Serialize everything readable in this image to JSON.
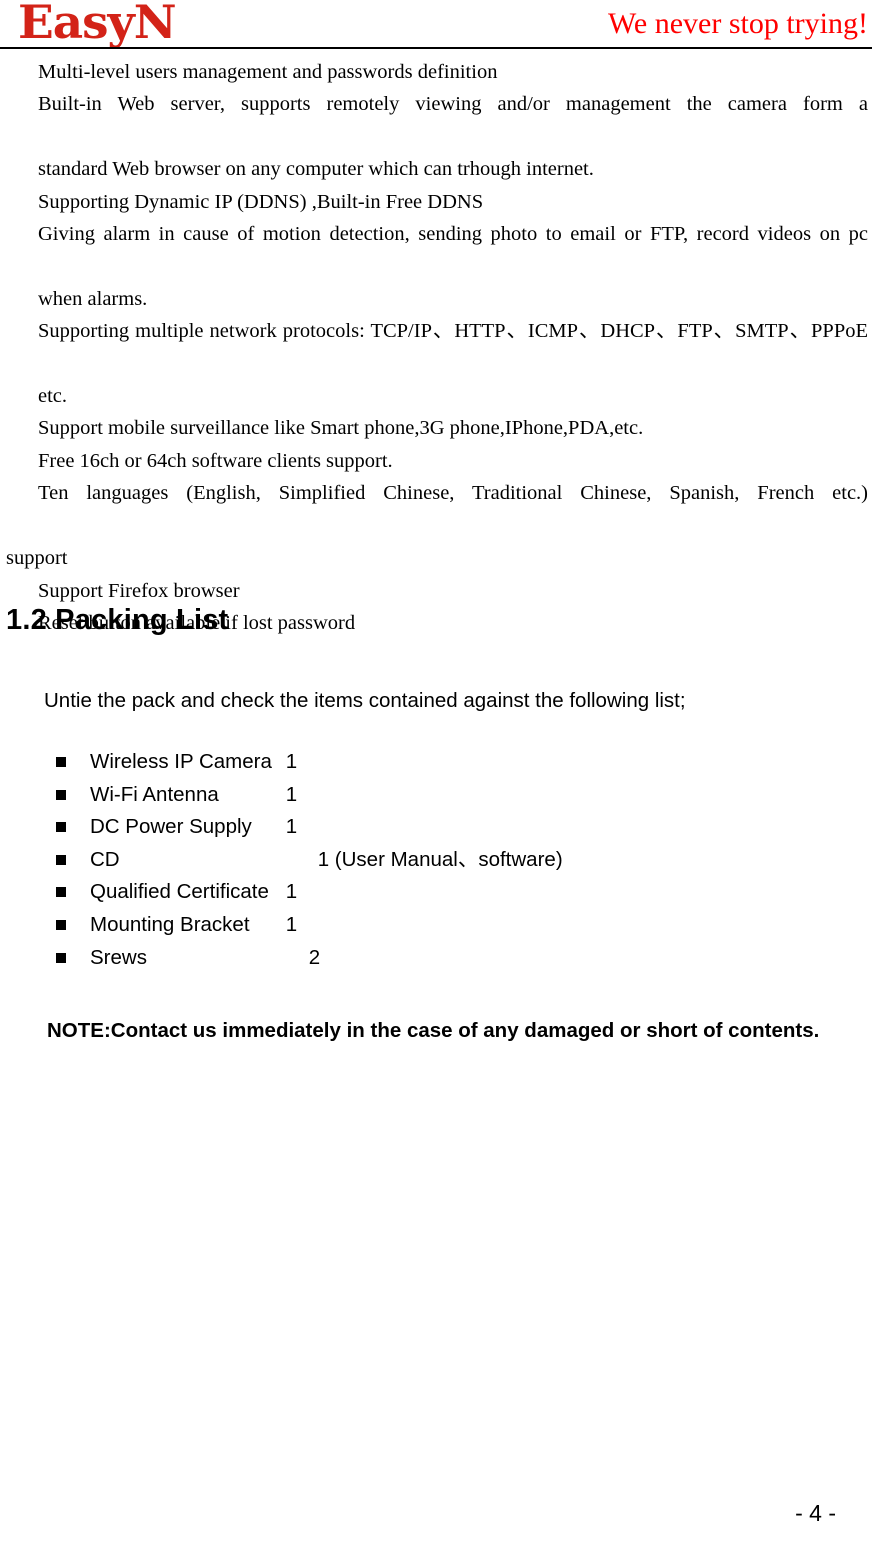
{
  "header": {
    "brand_logo": "EasyN",
    "tagline": "We never stop trying!",
    "logo_color": "#D32318",
    "tagline_color": "#FF0000"
  },
  "features": {
    "lines": [
      "Multi-level users management and passwords definition",
      "Built-in Web server, supports remotely viewing and/or management the camera form a standard Web browser on any computer which can trhough internet.",
      "Supporting Dynamic IP (DDNS) ,Built-in Free DDNS",
      "Giving alarm in cause of motion detection, sending photo to email or FTP, record videos on pc when alarms.",
      "Supporting multiple network protocols: TCP/IP、HTTP、ICMP、DHCP、FTP、SMTP、PPPoE etc.",
      "Support mobile surveillance like Smart phone,3G phone,IPhone,PDA,etc.",
      "Free 16ch or 64ch software clients support.",
      "Ten languages (English, Simplified Chinese, Traditional Chinese, Spanish, French etc.)",
      "support",
      "Support Firefox browser",
      "Reset button available if lost password"
    ],
    "l0": "Multi-level users management and passwords definition",
    "l1a": "Built-in Web server, supports remotely viewing and/or management the camera form a",
    "l1b": "standard Web browser on any computer which can trhough internet.",
    "l2": "Supporting Dynamic IP (DDNS) ,Built-in Free DDNS",
    "l3a": "Giving alarm in cause of motion detection, sending photo to email or FTP, record videos on pc",
    "l3b": "when alarms.",
    "l4a": "Supporting multiple network protocols: TCP/IP、HTTP、ICMP、DHCP、FTP、SMTP、PPPoE",
    "l4b": "etc.",
    "l5": "Support mobile surveillance like Smart phone,3G phone,IPhone,PDA,etc.",
    "l6": "Free 16ch or 64ch software clients support.",
    "l7a": "Ten languages (English, Simplified Chinese, Traditional Chinese, Spanish, French etc.)",
    "l7b": "support",
    "l8": "Support Firefox browser",
    "l9": "Reset button available if lost password"
  },
  "section": {
    "number": "1.2",
    "heading": "1.2 Packing List"
  },
  "packing": {
    "intro": "Untie the pack and check the items contained against the following list;",
    "items": [
      {
        "label": "Wireless IP Camera",
        "qty": "1",
        "label_width": "190px",
        "qty_offset": "0px"
      },
      {
        "label": "Wi-Fi Antenna",
        "qty": "1",
        "label_width": "190px",
        "qty_offset": "0px"
      },
      {
        "label": "DC Power Supply",
        "qty": "1",
        "label_width": "190px",
        "qty_offset": "0px"
      },
      {
        "label": "CD",
        "qty": "1 (User Manual、software)",
        "label_width": "190px",
        "qty_offset": "32px"
      },
      {
        "label": "Qualified Certificate",
        "qty": "1",
        "label_width": "190px",
        "qty_offset": "0px"
      },
      {
        "label": "Mounting Bracket",
        "qty": "1",
        "label_width": "190px",
        "qty_offset": "0px"
      },
      {
        "label": "Srews",
        "qty": "2",
        "label_width": "190px",
        "qty_offset": "23px"
      }
    ],
    "note": "NOTE:Contact us immediately in the case of any damaged or short of contents."
  },
  "footer": {
    "page_number": "- 4 -"
  }
}
